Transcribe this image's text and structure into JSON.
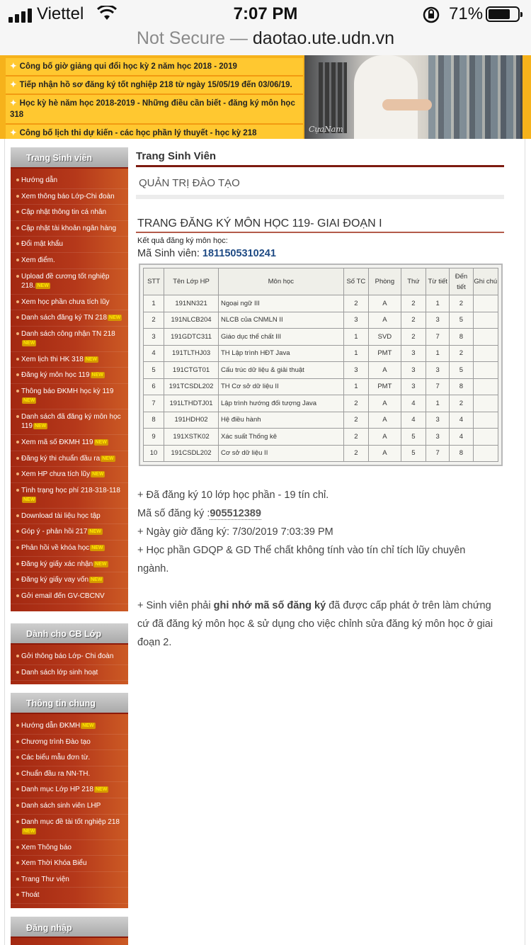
{
  "status_bar": {
    "carrier": "Viettel",
    "time": "7:07 PM",
    "battery": "71%",
    "signal_icon": "signal-bars-icon",
    "wifi_icon": "wifi-icon",
    "lock_icon": "orientation-lock-icon"
  },
  "url_bar": {
    "security": "Not Secure —",
    "domain": "daotao.ute.udn.vn"
  },
  "banner": {
    "news": [
      "Công bố giờ giảng qui đổi học kỳ 2 năm học 2018 - 2019",
      "Tiếp nhận hồ sơ đăng ký tốt nghiệp 218 từ ngày 15/05/19 đến 03/06/19.",
      "Học kỳ hè năm học 2018-2019 - Những điều cần biết - đăng ký môn học 318",
      "Công bố lịch thi dự kiến - các học phần lý thuyết - học kỳ 218"
    ],
    "photo_signature": "CựaNam"
  },
  "sidebar": {
    "student": {
      "title": "Trang Sinh viên",
      "items": [
        {
          "label": "Hướng dẫn",
          "new": false
        },
        {
          "label": "Xem thông báo Lớp-Chi đoàn",
          "new": false
        },
        {
          "label": "Cập nhật thông tin cá nhân",
          "new": false
        },
        {
          "label": "Cập nhật tài khoản ngân hàng",
          "new": false
        },
        {
          "label": "Đổi mật khẩu",
          "new": false
        },
        {
          "label": "Xem điểm.",
          "new": false
        },
        {
          "label": "Upload đề cương tốt nghiệp 218.",
          "new": true
        },
        {
          "label": "Xem học phần chưa tích lũy",
          "new": false
        },
        {
          "label": "Danh sách đăng ký TN 218",
          "new": true
        },
        {
          "label": "Danh sách công nhận TN 218",
          "new": true
        },
        {
          "label": "Xem lịch thi HK 318",
          "new": true
        },
        {
          "label": "Đăng ký môn học 119",
          "new": true
        },
        {
          "label": "Thông báo ĐKMH học kỳ 119",
          "new": true
        },
        {
          "label": "Danh sách đã đăng ký môn học 119",
          "new": true
        },
        {
          "label": "Xem mã số ĐKMH 119",
          "new": true
        },
        {
          "label": "Đăng ký thi chuẩn đầu ra",
          "new": true
        },
        {
          "label": "Xem HP chưa tích lũy",
          "new": true
        },
        {
          "label": "Tình trạng học phí 218-318-118",
          "new": true
        },
        {
          "label": "Download tài liệu học tập",
          "new": false
        },
        {
          "label": "Góp ý - phản hồi 217",
          "new": true
        },
        {
          "label": "Phản hồi về khóa học",
          "new": true
        },
        {
          "label": "Đăng ký giấy xác nhận",
          "new": true
        },
        {
          "label": "Đăng ký giấy vay vốn",
          "new": true
        },
        {
          "label": "Gởi email đến GV-CBCNV",
          "new": false
        }
      ]
    },
    "staff": {
      "title": "Dành cho CB Lớp",
      "items": [
        {
          "label": "Gởi thông báo Lớp- Chi đoàn",
          "new": false
        },
        {
          "label": "Danh sách lớp sinh hoạt",
          "new": false
        }
      ]
    },
    "general": {
      "title": "Thông tin chung",
      "items": [
        {
          "label": "Hướng dẫn ĐKMH",
          "new": true
        },
        {
          "label": "Chương trình Đào tạo",
          "new": false
        },
        {
          "label": "Các biểu mẫu đơn từ.",
          "new": false
        },
        {
          "label": "Chuẩn đầu ra NN-TH.",
          "new": false
        },
        {
          "label": "Danh mục Lớp HP 218",
          "new": true
        },
        {
          "label": "Danh sách sinh viên LHP",
          "new": false
        },
        {
          "label": "Danh mục đề tài tốt nghiệp 218",
          "new": true
        },
        {
          "label": "Xem Thông báo",
          "new": false
        },
        {
          "label": "Xem Thời Khóa Biểu",
          "new": false
        },
        {
          "label": "Trang Thư viện",
          "new": false
        },
        {
          "label": "Thoát",
          "new": false
        }
      ]
    },
    "login": {
      "title": "Đăng nhập"
    },
    "new_tag": "NEW"
  },
  "main": {
    "page_title": "Trang Sinh Viên",
    "section": "QUẢN TRỊ ĐÀO TẠO",
    "reg_title": "TRANG ĐĂNG KÝ MÔN HỌC 119- GIAI ĐOẠN I",
    "result_label": "Kết quả đăng ký môn học:",
    "student_id_label": "Mã Sinh viên: ",
    "student_id": "1811505310241"
  },
  "table": {
    "headers": [
      "STT",
      "Tên Lớp HP",
      "Môn học",
      "Số TC",
      "Phòng",
      "Thứ",
      "Từ tiết",
      "Đến tiết",
      "Ghi chú"
    ],
    "rows": [
      [
        "1",
        "191NN321",
        "Ngoại ngữ III",
        "2",
        "A",
        "2",
        "1",
        "2",
        ""
      ],
      [
        "2",
        "191NLCB204",
        "NLCB của CNMLN II",
        "3",
        "A",
        "2",
        "3",
        "5",
        ""
      ],
      [
        "3",
        "191GDTC311",
        "Giáo dục thể chất III",
        "1",
        "SVD",
        "2",
        "7",
        "8",
        ""
      ],
      [
        "4",
        "191TLTHJ03",
        "TH Lập trình HĐT Java",
        "1",
        "PMT",
        "3",
        "1",
        "2",
        ""
      ],
      [
        "5",
        "191CTGT01",
        "Cấu trúc dữ liệu & giải thuật",
        "3",
        "A",
        "3",
        "3",
        "5",
        ""
      ],
      [
        "6",
        "191TCSDL202",
        "TH Cơ sở dữ liệu II",
        "1",
        "PMT",
        "3",
        "7",
        "8",
        ""
      ],
      [
        "7",
        "191LTHDTJ01",
        "Lập trình hướng đối tượng Java",
        "2",
        "A",
        "4",
        "1",
        "2",
        ""
      ],
      [
        "8",
        "191HDH02",
        "Hệ điều hành",
        "2",
        "A",
        "4",
        "3",
        "4",
        ""
      ],
      [
        "9",
        "191XSTK02",
        "Xác suất Thống kê",
        "2",
        "A",
        "5",
        "3",
        "4",
        ""
      ],
      [
        "10",
        "191CSDL202",
        "Cơ sở dữ liệu II",
        "2",
        "A",
        "5",
        "7",
        "8",
        ""
      ]
    ]
  },
  "notes": {
    "registered": "+ Đã đăng ký 10 lớp học phần - 19 tín chỉ.",
    "code_label": "Mã số đăng ký :",
    "code": "905512389",
    "datetime": "+ Ngày giờ đăng ký: 7/30/2019 7:03:39 PM",
    "gdqp": "+ Học phần GDQP & GD Thể chất không tính vào tín chỉ tích lũy chuyên ngành.",
    "remember_pre": "+ Sinh viên phải ",
    "remember_bold": "ghi nhớ mã số đăng ký",
    "remember_post": " đã được cấp phát ở trên làm chứng cứ đã đăng ký môn học & sử dụng cho việc chỉnh sửa đăng ký môn học ở giai đoạn 2."
  }
}
